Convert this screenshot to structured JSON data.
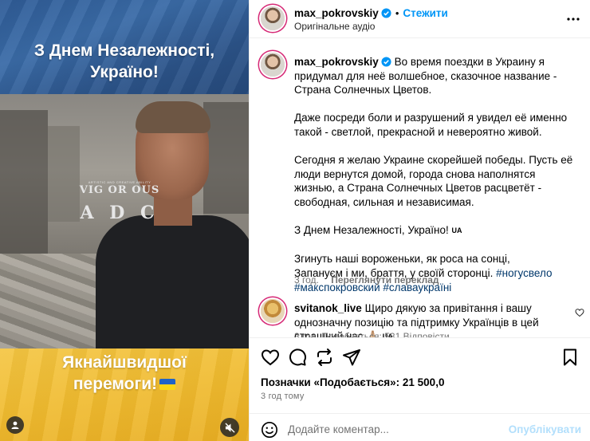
{
  "media": {
    "title_line1": "З Днем Незалежності,",
    "title_line2": "Україно!",
    "shirt_sub": "ARTISTIC AND CREATIVE ABILITY",
    "shirt_brand": "VIG OR OUS",
    "shirt_letters": "A  D  C",
    "wish_line1": "Якнайшвидшої",
    "wish_line2": "перемоги!"
  },
  "header": {
    "username": "max_pokrovskiy",
    "separator": "•",
    "follow_label": "Стежити",
    "audio": "Оригінальне аудіо"
  },
  "caption": {
    "username": "max_pokrovskiy",
    "p1": "Во время поездки в Украину я придумал для неё волшебное, сказочное название - Страна Солнечных Цветов.",
    "p2": "Даже посреди боли и разрушений я увидел её именно такой - светлой, прекрасной и невероятно живой.",
    "p3": "Сегодня я желаю Украине скорейшей победы. Пусть её люди вернутся домой, города снова наполнятся жизнью, а Страна Солнечных Цветов расцветёт - свободная, сильная и независимая.",
    "p4": "З Днем Незалежності, Україно!",
    "p4_flag": "UA",
    "p5_line1": "Згинуть наші вороженьки, як роса на сонці,",
    "p5_line2": "Запануєм і ми, браття, у своїй сторонці.",
    "tag1": "#ногусвело",
    "tag2": "#макспокровский",
    "tag3": "#славаукраїні",
    "age": "3 год.",
    "translate_label": "Переглянути переклад"
  },
  "comment": {
    "username": "svitanok_live",
    "text": "Щиро дякую за привітання і вашу однозначну позицію та підтримку Українців в цей страшний час",
    "emoji": "🙏🏼",
    "flag": "UA",
    "meta": "3 год.    Подобається: 531    Відповісти"
  },
  "actions": {
    "likes": "Позначки «Подобається»: 21 500,0",
    "time": "3 год тому"
  },
  "add_comment": {
    "placeholder": "Додайте коментар...",
    "publish_label": "Опублікувати"
  },
  "colors": {
    "accent": "#0095f6",
    "hashtag": "#00376b",
    "muted": "#737373",
    "border": "#efefef",
    "publish_disabled": "#b2dffc"
  }
}
